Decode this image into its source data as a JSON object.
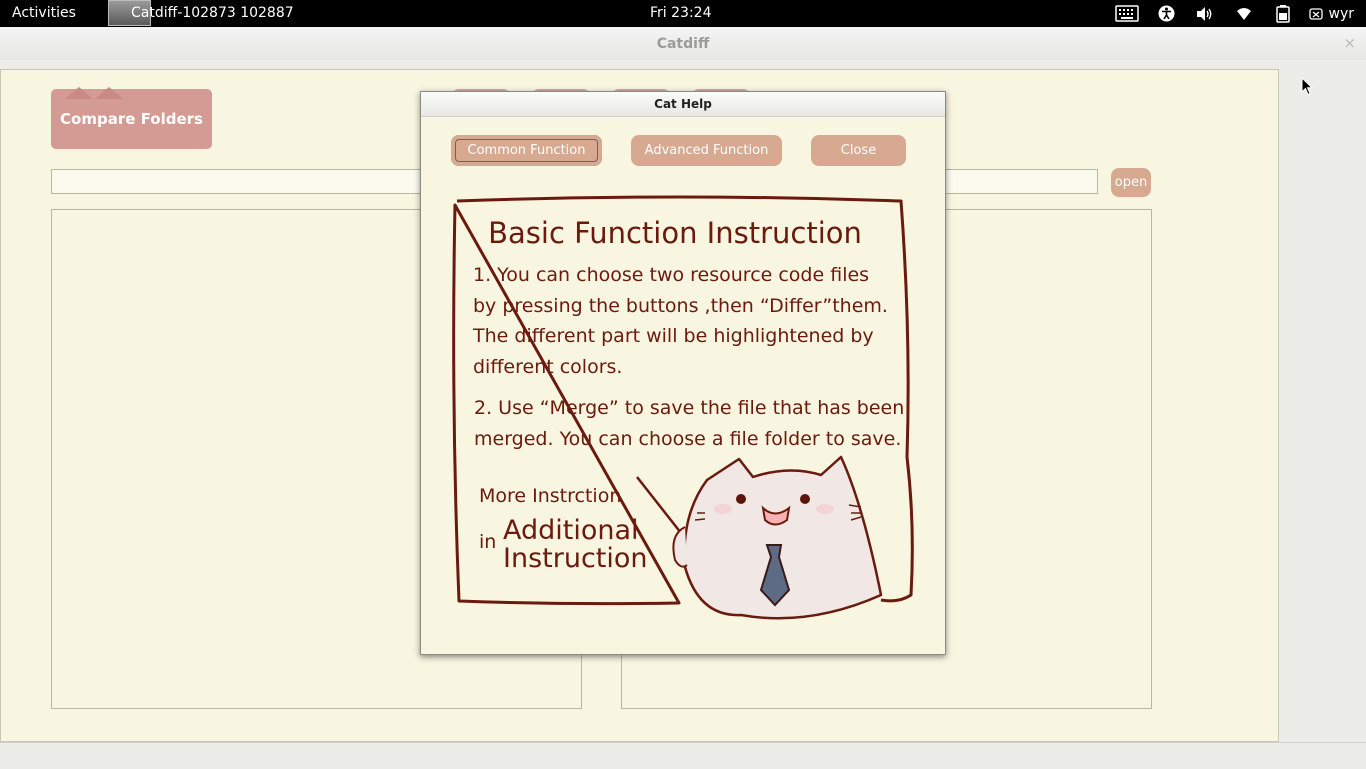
{
  "topbar": {
    "activities": "Activities",
    "app_title": "Catdiff-102873 102887",
    "clock": "Fri 23:24",
    "user": "wyr"
  },
  "window": {
    "title": "Catdiff",
    "close": "×"
  },
  "toolbar": {
    "compare_folders": "Compare Folders",
    "open": "open"
  },
  "dialog": {
    "title": "Cat Help",
    "buttons": {
      "common": "Common Function",
      "advanced": "Advanced Function",
      "close": "Close"
    },
    "help": {
      "heading": "Basic Function Instruction",
      "item1": [
        "1. You can choose two resource code files",
        "by pressing the buttons ,then “Differ”them.",
        "The different part will be highlightened by",
        "different colors."
      ],
      "item2": [
        "2. Use  “Merge” to save the file that has been",
        "merged. You can choose  a file folder to save."
      ],
      "more": "More Instrction",
      "in": "in",
      "additional": "Additional",
      "instruction": "Instruction"
    }
  },
  "colors": {
    "background": "#f8f5e0",
    "button": "#d7a990",
    "folder_button": "#d49b94",
    "help_text": "#6b1a0e"
  },
  "icons": [
    "keyboard-icon",
    "accessibility-icon",
    "volume-icon",
    "wifi-icon",
    "battery-icon",
    "user-icon",
    "cat-mascot"
  ]
}
